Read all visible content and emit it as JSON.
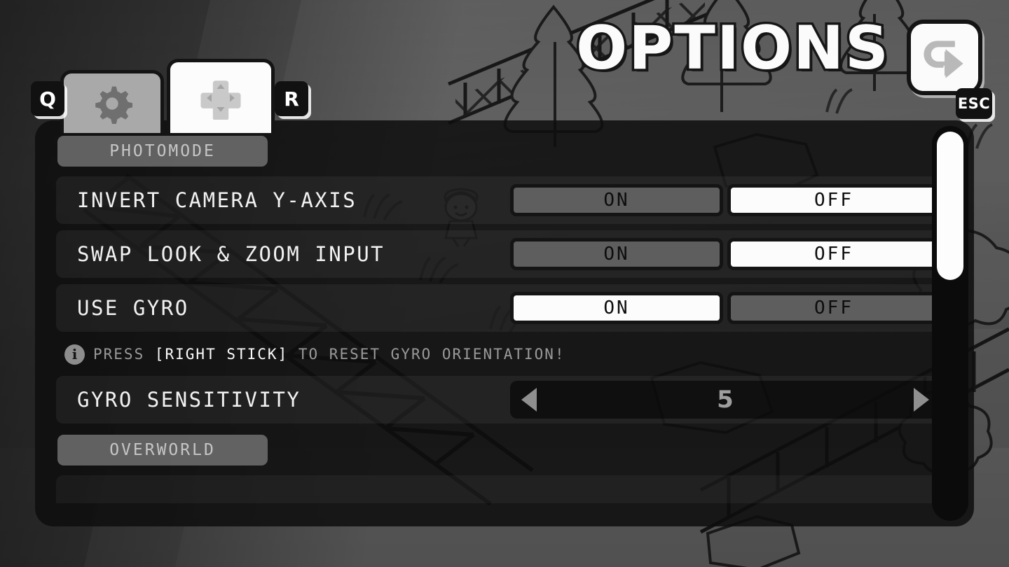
{
  "header": {
    "title": "OPTIONS",
    "back_icon": "return-arrow-icon",
    "back_key": "ESC"
  },
  "tabs": {
    "prev_key": "Q",
    "next_key": "R",
    "items": [
      {
        "id": "general",
        "icon": "gear-icon",
        "active": false
      },
      {
        "id": "controls",
        "icon": "dpad-icon",
        "active": true
      }
    ]
  },
  "sections": [
    {
      "id": "photomode",
      "header": "PHOTOMODE",
      "rows": [
        {
          "id": "invert-camera-y-axis",
          "label": "INVERT CAMERA Y-AXIS",
          "type": "toggle",
          "options": [
            "ON",
            "OFF"
          ],
          "selected": "OFF"
        },
        {
          "id": "swap-look-zoom-input",
          "label": "SWAP LOOK & ZOOM INPUT",
          "type": "toggle",
          "options": [
            "ON",
            "OFF"
          ],
          "selected": "OFF"
        },
        {
          "id": "use-gyro",
          "label": "USE GYRO",
          "type": "toggle",
          "options": [
            "ON",
            "OFF"
          ],
          "selected": "ON",
          "hint": {
            "icon": "info-icon",
            "prefix": "PRESS ",
            "highlight": "[RIGHT STICK]",
            "suffix": " TO RESET GYRO ORIENTATION!"
          }
        },
        {
          "id": "gyro-sensitivity",
          "label": "GYRO SENSITIVITY",
          "type": "stepper",
          "value": "5",
          "left_arrow": "chevron-left-icon",
          "right_arrow": "chevron-right-icon"
        }
      ]
    },
    {
      "id": "overworld",
      "header": "OVERWORLD",
      "rows": []
    }
  ],
  "scrollbar": {
    "name": "vertical-scrollbar",
    "thumb_position_percent": 2,
    "thumb_size_percent": 37
  },
  "colors": {
    "panel": "#0e0e0e",
    "selected": "#fcfcfc",
    "unselected": "#5e5e5e",
    "label": "#f2f2f2",
    "muted": "#9a9a9a",
    "section_header_bg": "#767676"
  }
}
